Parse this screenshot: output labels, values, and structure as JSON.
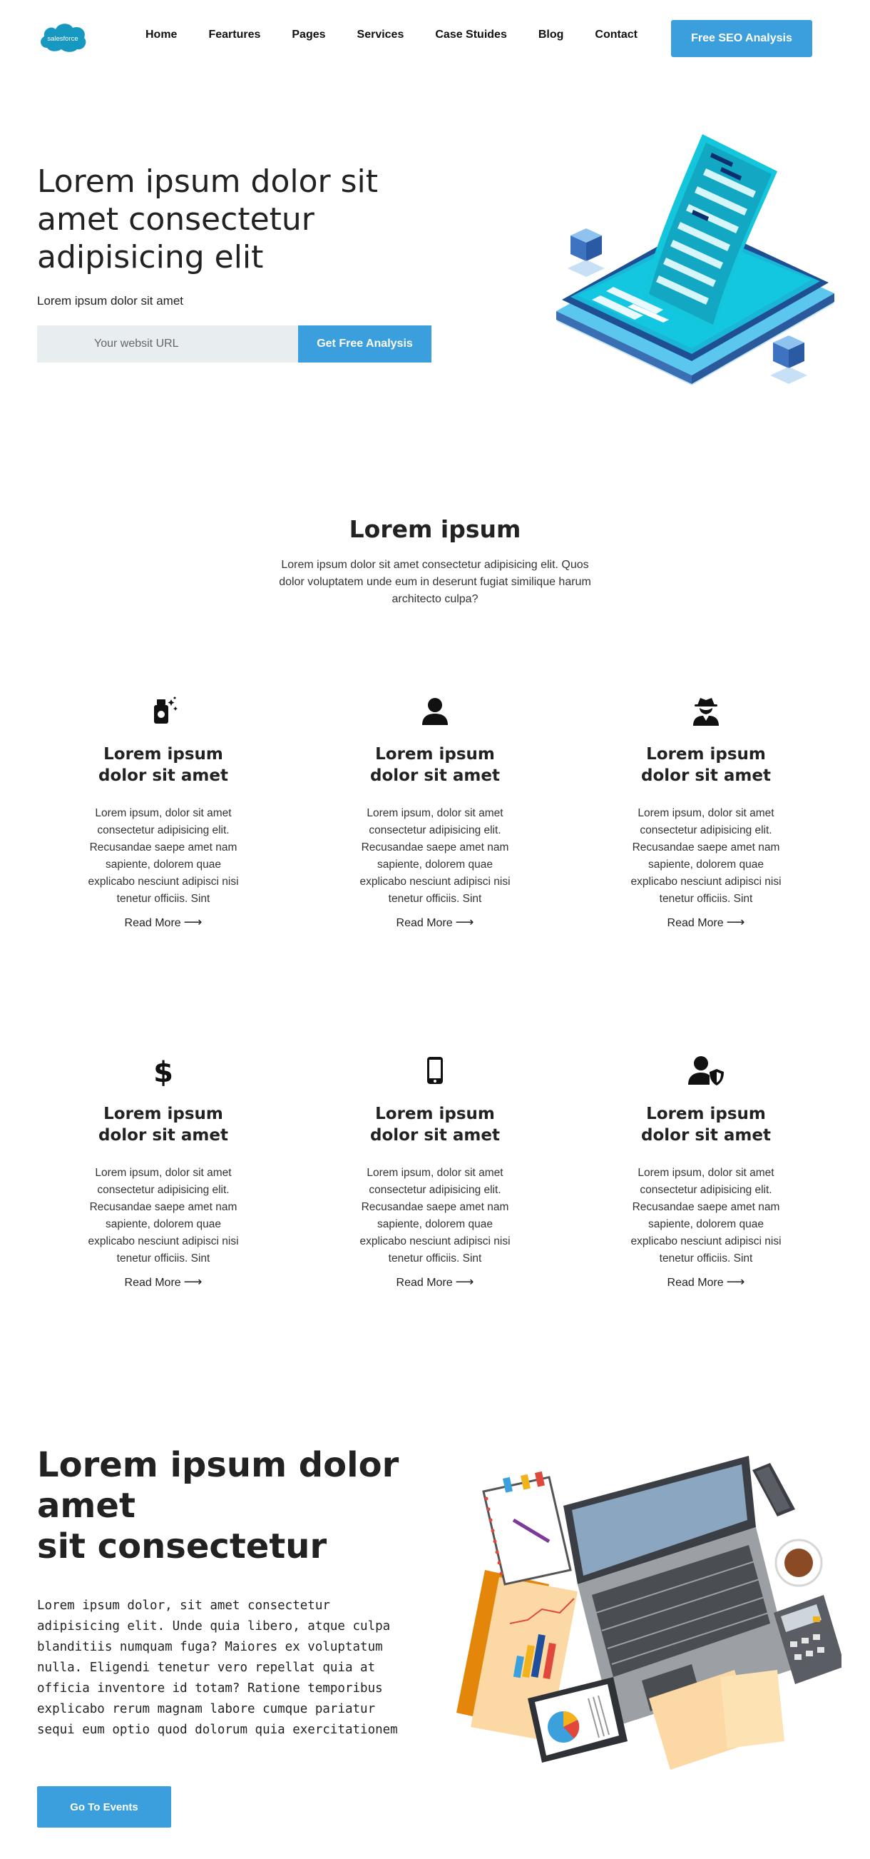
{
  "nav": {
    "logo_text": "salesforce",
    "links": [
      "Home",
      "Feartures",
      "Pages",
      "Services",
      "Case Stuides",
      "Blog",
      "Contact"
    ],
    "cta_label": "Free SEO Analysis"
  },
  "hero": {
    "title": "Lorem ipsum dolor sit amet consectetur adipisicing elit",
    "subtitle": "Lorem ipsum dolor sit amet",
    "url_placeholder": "Your websit URL",
    "submit_label": "Get Free Analysis"
  },
  "features_intro": {
    "title": "Lorem ipsum",
    "description": "Lorem ipsum dolor sit amet consectetur adipisicing elit. Quos dolor voluptatem unde eum in deserunt fugiat similique harum architecto culpa?"
  },
  "cards": [
    {
      "icon": "spray-bottle-icon",
      "title": "Lorem ipsum dolor sit amet",
      "text": "Lorem ipsum, dolor sit amet consectetur adipisicing elit. Recusandae saepe amet nam sapiente, dolorem quae explicabo nesciunt adipisci nisi tenetur officiis. Sint",
      "link": "Read More"
    },
    {
      "icon": "user-icon",
      "title": "Lorem ipsum dolor sit amet",
      "text": "Lorem ipsum, dolor sit amet consectetur adipisicing elit. Recusandae saepe amet nam sapiente, dolorem quae explicabo nesciunt adipisci nisi tenetur officiis. Sint",
      "link": "Read More"
    },
    {
      "icon": "user-secret-icon",
      "title": "Lorem ipsum dolor sit amet",
      "text": "Lorem ipsum, dolor sit amet consectetur adipisicing elit. Recusandae saepe amet nam sapiente, dolorem quae explicabo nesciunt adipisci nisi tenetur officiis. Sint",
      "link": "Read More"
    },
    {
      "icon": "dollar-icon",
      "title": "Lorem ipsum dolor sit amet",
      "text": "Lorem ipsum, dolor sit amet consectetur adipisicing elit. Recusandae saepe amet nam sapiente, dolorem quae explicabo nesciunt adipisci nisi tenetur officiis. Sint",
      "link": "Read More"
    },
    {
      "icon": "mobile-icon",
      "title": "Lorem ipsum dolor sit amet",
      "text": "Lorem ipsum, dolor sit amet consectetur adipisicing elit. Recusandae saepe amet nam sapiente, dolorem quae explicabo nesciunt adipisci nisi tenetur officiis. Sint",
      "link": "Read More"
    },
    {
      "icon": "user-shield-icon",
      "title": "Lorem ipsum dolor sit amet",
      "text": "Lorem ipsum, dolor sit amet consectetur adipisicing elit. Recusandae saepe amet nam sapiente, dolorem quae explicabo nesciunt adipisci nisi tenetur officiis. Sint",
      "link": "Read More"
    }
  ],
  "events": {
    "title_line1": "Lorem ipsum dolor amet",
    "title_line2": "sit consectetur",
    "text": "Lorem ipsum dolor, sit amet consectetur adipisicing elit. Unde quia libero, atque culpa blanditiis numquam fuga? Maiores ex voluptatum nulla. Eligendi tenetur vero repellat quia at officia inventore id totam? Ratione temporibus explicabo rerum magnam labore cumque pariatur sequi eum optio quod dolorum quia exercitationem",
    "button_label": "Go To Events"
  },
  "colors": {
    "accent": "#3a9fdc",
    "input_bg": "#e8edf0",
    "text": "#222222",
    "logo_blue": "#1798c1"
  }
}
